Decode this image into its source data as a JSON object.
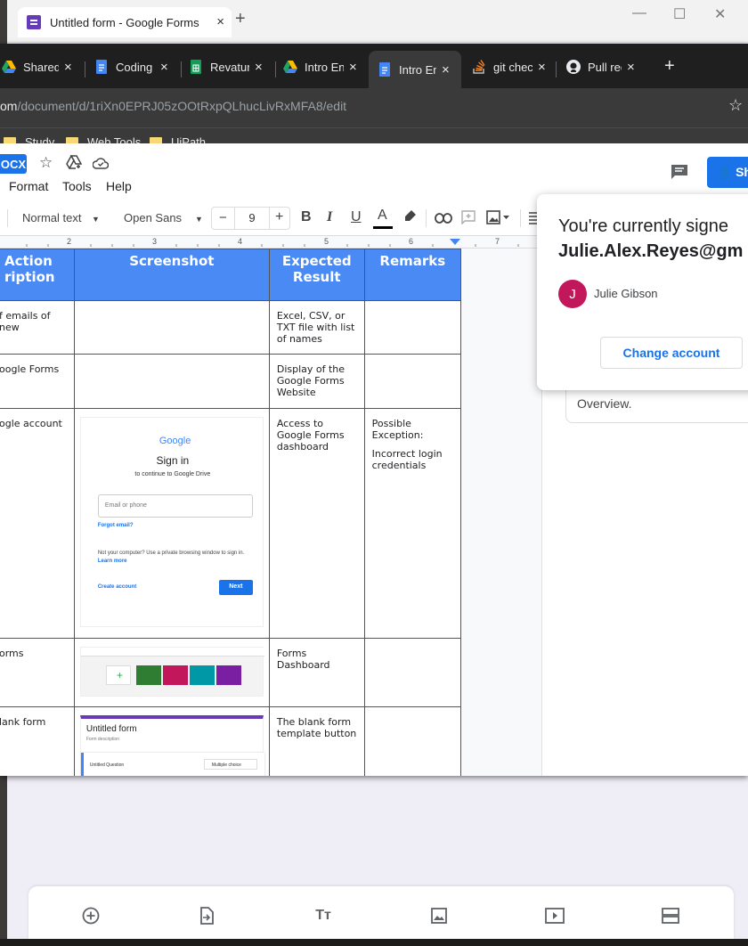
{
  "back_window": {
    "tab_title": "Untitled form - Google Forms",
    "close_glyph": "×",
    "new_tab_glyph": "+",
    "window_controls": [
      "—",
      "☐",
      "✕"
    ],
    "bottom_toolbar_icons": [
      "add-question-icon",
      "import-questions-icon",
      "add-title-icon",
      "add-image-icon",
      "add-video-icon",
      "add-section-icon"
    ]
  },
  "front_window": {
    "tabs": [
      {
        "label": "Shared",
        "icon": "drive-icon",
        "active": false
      },
      {
        "label": "Coding",
        "icon": "docs-icon",
        "active": false
      },
      {
        "label": "Revatur",
        "icon": "sheets-icon",
        "active": false
      },
      {
        "label": "Intro En",
        "icon": "drive-icon",
        "active": false
      },
      {
        "label": "Intro En",
        "icon": "docs-icon",
        "active": true
      },
      {
        "label": "git chec",
        "icon": "stackoverflow-icon",
        "active": false
      },
      {
        "label": "Pull req",
        "icon": "github-icon",
        "active": false
      }
    ],
    "tab_close_glyph": "×",
    "new_tab_glyph": "+",
    "url_domain_part": "om",
    "url_path": "/document/d/1riXn0EPRJ05zOOtRxpQLhucLivRxMFA8/edit",
    "bookmarks": [
      "Study",
      "Web Tools",
      "UiPath"
    ]
  },
  "docs": {
    "file_badge": "OCX",
    "menus": [
      "Format",
      "Tools",
      "Help"
    ],
    "share_label": "Sh",
    "style_dropdown": "Normal text",
    "font_dropdown": "Open Sans",
    "font_size": "9",
    "minus": "−",
    "plus": "+",
    "ruler_numbers": [
      "2",
      "3",
      "4",
      "5",
      "6",
      "7"
    ]
  },
  "table": {
    "headers": [
      "Action\nription",
      "Screenshot",
      "Expected Result",
      "Remarks"
    ],
    "rows": [
      {
        "action": "f emails of new",
        "expected": "Excel, CSV, or TXT file with list of names",
        "remarks": ""
      },
      {
        "action": "oogle Forms",
        "expected": "Display of the Google Forms Website",
        "remarks": ""
      },
      {
        "action": "ogle account",
        "expected": "Access to Google Forms dashboard",
        "remarks": "Possible Exception:",
        "remarks2": "Incorrect login credentials"
      },
      {
        "action": "orms",
        "expected": "Forms Dashboard",
        "remarks": ""
      },
      {
        "action": "lank form",
        "expected": "The blank form template button",
        "remarks": ""
      }
    ],
    "signin_mock": {
      "logo": "Google",
      "title": "Sign in",
      "subtitle": "to continue to Google Drive",
      "email_placeholder": "Email or phone",
      "forgot": "Forgot email?",
      "notice": "Not your computer? Use a private browsing window to sign in.",
      "learn_more": "Learn more",
      "create": "Create account",
      "next": "Next"
    },
    "form_mock": {
      "title": "Untitled form",
      "desc": "Form description",
      "question": "Untitled Question",
      "type": "Multiple choice"
    }
  },
  "account_popup": {
    "line1": "You're currently signe",
    "line2": "Julie.Alex.Reyes@gm",
    "avatar_letter": "J",
    "name": "Julie Gibson",
    "change_button": "Change account"
  },
  "overview_text": "Overview.",
  "colors": {
    "accent": "#1a73e8",
    "table_header": "#4a8af4",
    "forms_purple": "#673ab7",
    "avatar": "#c2185b"
  }
}
